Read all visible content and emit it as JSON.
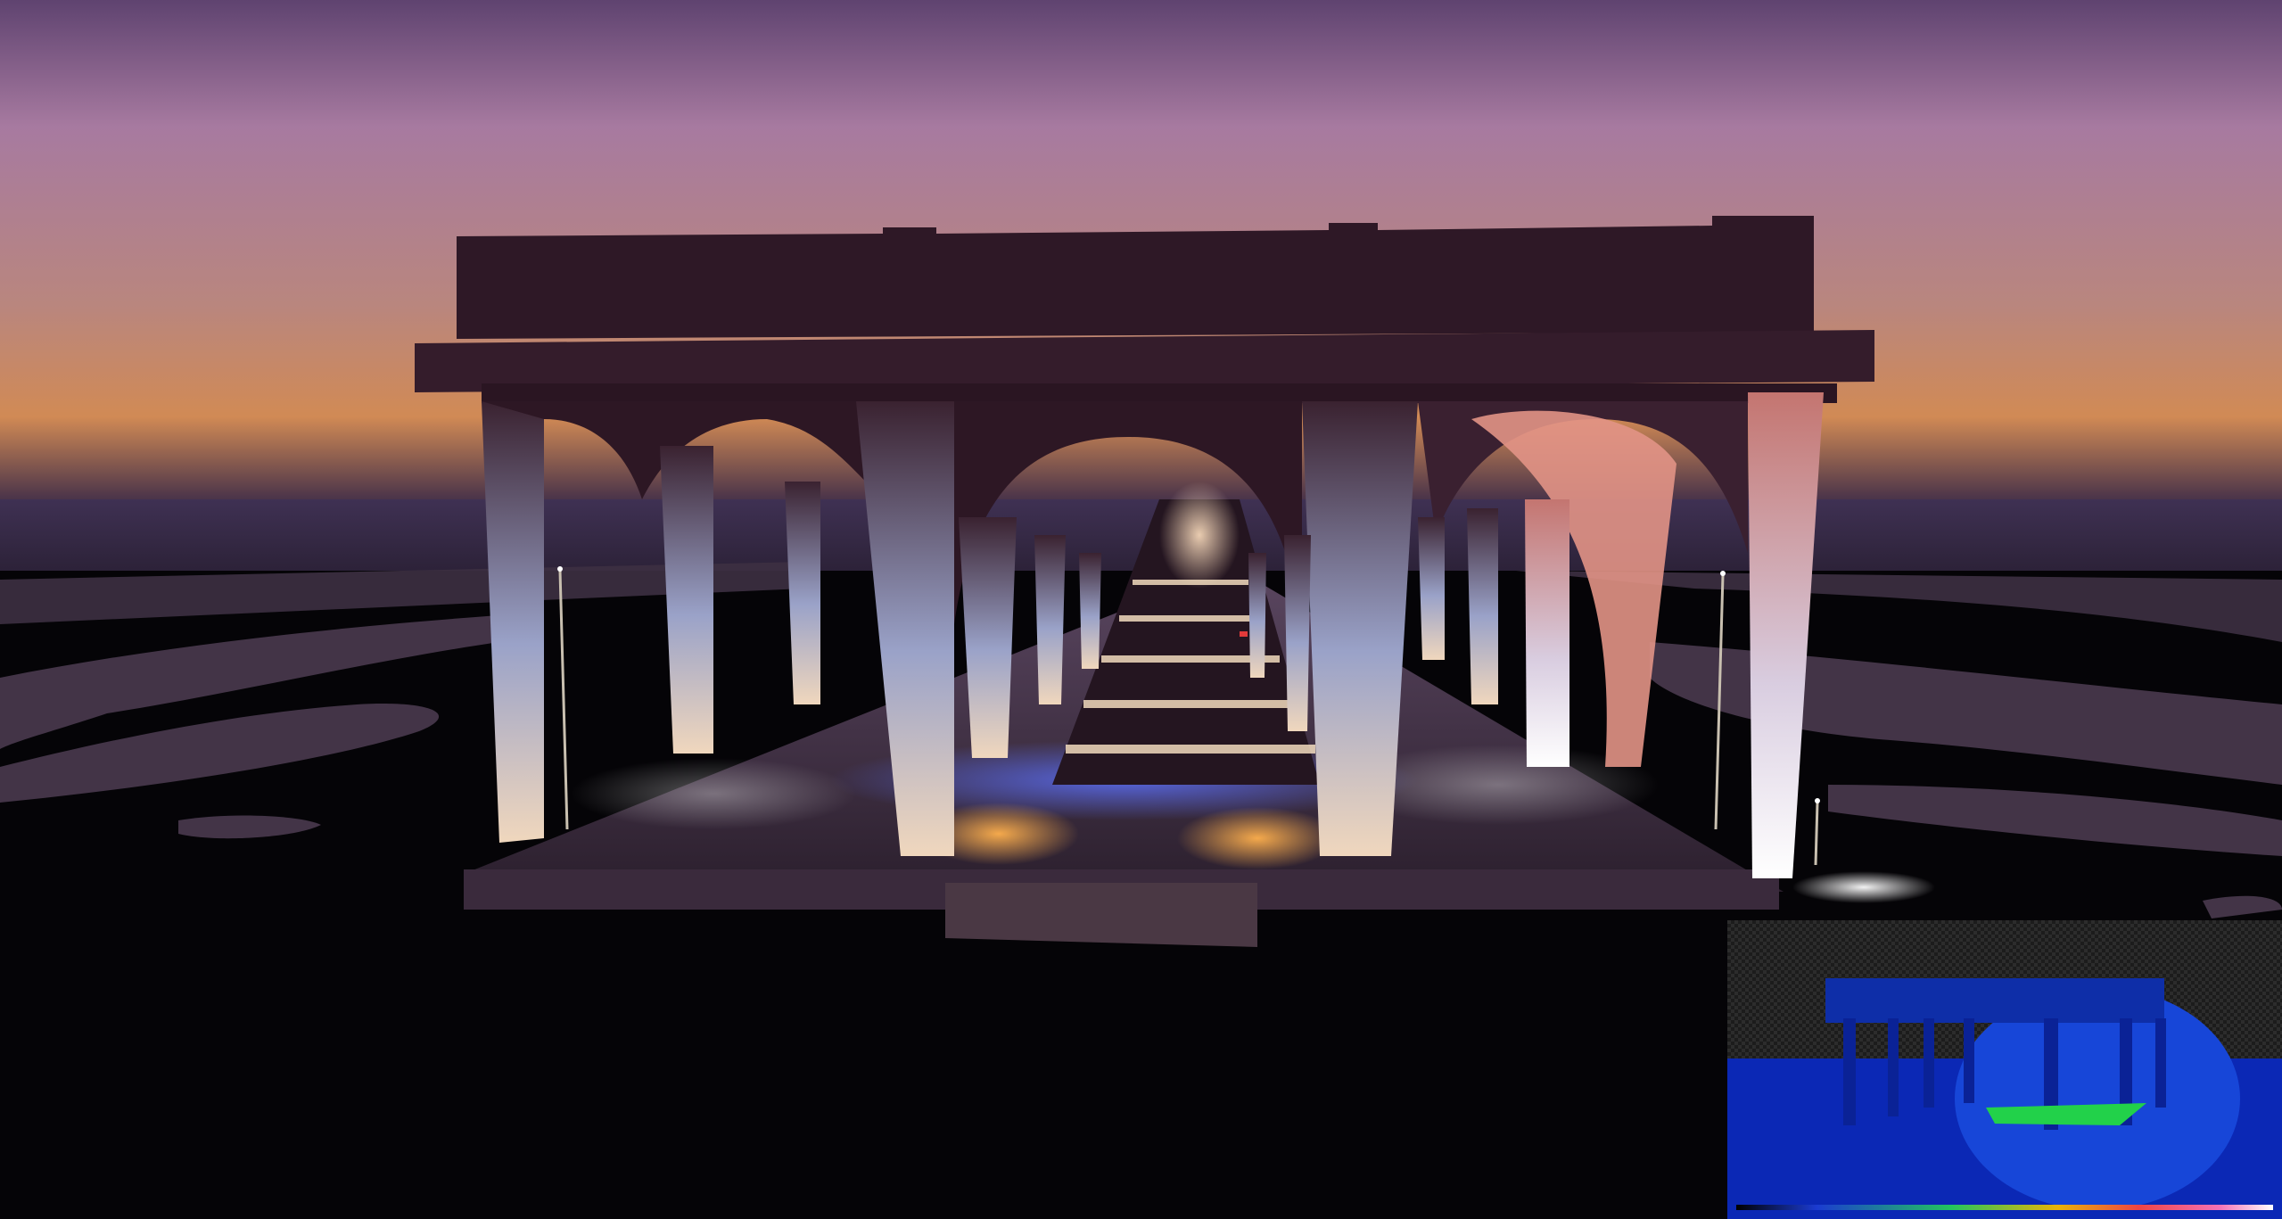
{
  "viewport": {
    "sky_colors": [
      "#6f4f78",
      "#a57a9c",
      "#b17a83",
      "#c47a5a",
      "#3a2b45"
    ],
    "ground_color": "#050407",
    "structure_color": "#2d1724",
    "light_colors": {
      "warm": "#f2a24a",
      "cool": "#9fb3ff",
      "pink": "#e59a8a",
      "blue": "#3b4fc8"
    }
  },
  "lighting_complexity_view": {
    "background_color": "#0a26b8",
    "highlight_color": "#21d14a",
    "sky_pattern_color": "#2a2a2a",
    "gradient_colors": [
      "#000000",
      "#1b3bd1",
      "#22c55e",
      "#eab308",
      "#ef4444",
      "#f472b6",
      "#ffffff"
    ]
  }
}
